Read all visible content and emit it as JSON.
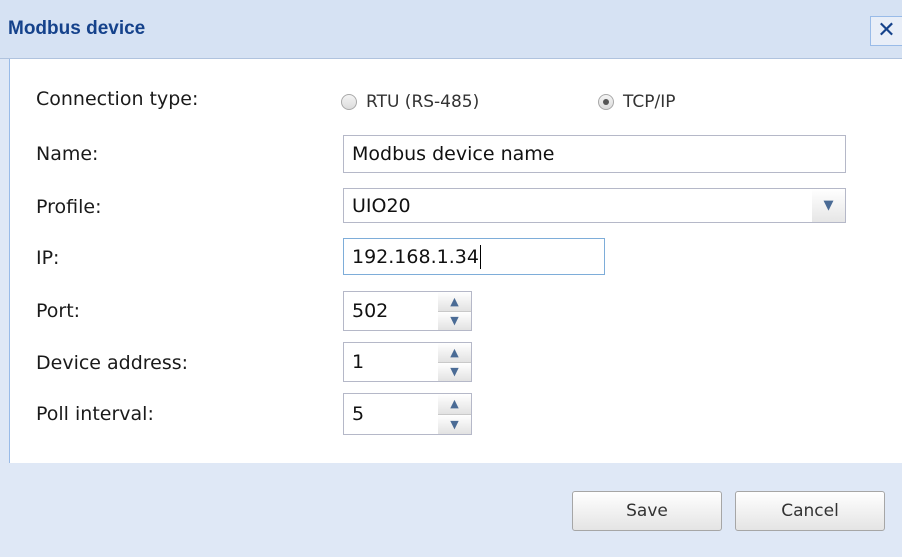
{
  "dialog": {
    "title": "Modbus device",
    "close_label": "✕"
  },
  "form": {
    "connection_type_label": "Connection type:",
    "connection_options": [
      {
        "label": "RTU (RS-485)",
        "checked": false
      },
      {
        "label": "TCP/IP",
        "checked": true
      }
    ],
    "name_label": "Name:",
    "name_value": "Modbus device name",
    "profile_label": "Profile:",
    "profile_value": "UIO20",
    "ip_label": "IP:",
    "ip_value": "192.168.1.34",
    "port_label": "Port:",
    "port_value": "502",
    "device_address_label": "Device address:",
    "device_address_value": "1",
    "poll_interval_label": "Poll interval:",
    "poll_interval_value": "5"
  },
  "buttons": {
    "save_label": "Save",
    "cancel_label": "Cancel"
  },
  "icons": {
    "combo": "chevron-down-icon",
    "spinner_up": "chevron-up-icon",
    "spinner_down": "chevron-down-icon",
    "close": "close-icon"
  },
  "colors": {
    "title_text": "#15428b",
    "header_bg": "#d6e2f3",
    "footer_bg": "#dfe8f6",
    "field_border": "#b5b8c8"
  }
}
